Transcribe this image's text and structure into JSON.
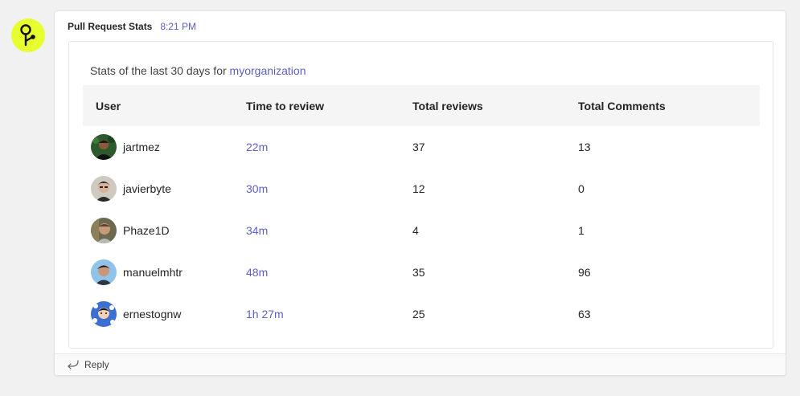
{
  "message": {
    "sender": "Pull Request Stats",
    "timestamp": "8:21 PM",
    "app_icon": "git-branch-icon"
  },
  "card": {
    "summary_prefix": "Stats of the last 30 days for",
    "organization": "myorganization",
    "columns": [
      "User",
      "Time to review",
      "Total reviews",
      "Total Comments"
    ],
    "rows": [
      {
        "user": "jartmez",
        "time": "22m",
        "reviews": "37",
        "comments": "13"
      },
      {
        "user": "javierbyte",
        "time": "30m",
        "reviews": "12",
        "comments": "0"
      },
      {
        "user": "Phaze1D",
        "time": "34m",
        "reviews": "4",
        "comments": "1"
      },
      {
        "user": "manuelmhtr",
        "time": "48m",
        "reviews": "35",
        "comments": "96"
      },
      {
        "user": "ernestognw",
        "time": "1h 27m",
        "reviews": "25",
        "comments": "63"
      }
    ]
  },
  "reply": {
    "label": "Reply",
    "icon": "reply-arrow-icon"
  },
  "colors": {
    "accent": "#5b5fc7",
    "app_icon_bg": "#e7ff2f",
    "header_bg": "#f5f5f5"
  }
}
